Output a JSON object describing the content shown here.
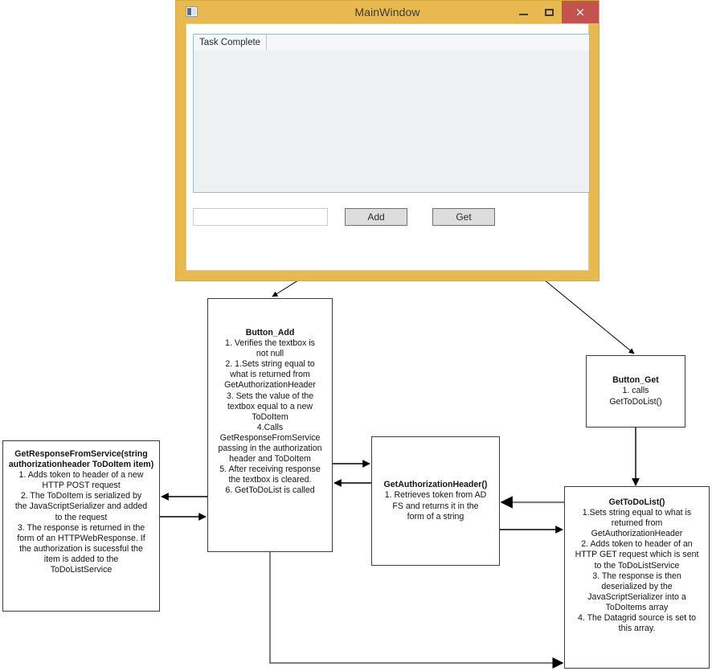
{
  "window": {
    "title": "MainWindow",
    "icon": "app-icon",
    "buttons": {
      "minimize": "–",
      "maximize": "□",
      "close": "×"
    },
    "datagrid": {
      "columns": [
        "Task Complete"
      ],
      "rows": []
    },
    "textbox_value": "",
    "textbox_placeholder": "",
    "add_label": "Add",
    "get_label": "Get"
  },
  "colors": {
    "window_chrome": "#e8b94f",
    "close_button": "#c4524f",
    "grid_border": "#9fb8c8",
    "box_border": "#3b3b3b",
    "connector_black": "#000000",
    "connector_gray": "#7f7f7f"
  },
  "boxes": {
    "button_add": {
      "title": "Button_Add",
      "steps": [
        "1.  Verifies the textbox is",
        "not null",
        "2.  1.Sets string equal to",
        "what is returned from",
        "GetAuthorizationHeader",
        "3.  Sets the value of the",
        "textbox equal to a new",
        "ToDoItem",
        "4.Calls",
        "GetResponseFromService",
        "passing in the authorization",
        "header and ToDoItem",
        "5.  After receiving response",
        "the textbox is cleared.",
        "6.  GetToDoList is called"
      ]
    },
    "button_get": {
      "title": "Button_Get",
      "steps": [
        "1.  calls",
        "GetToDoList()"
      ]
    },
    "get_response_from_service": {
      "title": "GetResponseFromService(string authorizationheader ToDoItem item)",
      "steps": [
        "1.   Adds token to header of a new",
        "HTTP POST request",
        "2.  The ToDoItem is serialized by",
        "the JavaScriptSerializer and added",
        "to the request",
        "3.  The response is returned in the",
        "form of an HTTPWebResponse.  If",
        "the authorization is sucessful the",
        "item is added to the",
        "ToDoListService"
      ]
    },
    "get_authorization_header": {
      "title": "GetAuthorizationHeader()",
      "steps": [
        "1. Retrieves token from AD",
        "FS and returns it in the",
        "form of a string"
      ]
    },
    "get_todo_list": {
      "title": "GetToDoList()",
      "steps": [
        "1.Sets string equal to what is",
        "returned from",
        "GetAuthorizationHeader",
        "2. Adds token to header of an",
        "HTTP GET request which is sent",
        "to the ToDoListService",
        "3.  The response is then",
        "deserialized by the",
        "JavaScriptSerializer into a",
        "ToDoItems array",
        "4.  The Datagrid source is set to",
        "this array."
      ]
    }
  }
}
